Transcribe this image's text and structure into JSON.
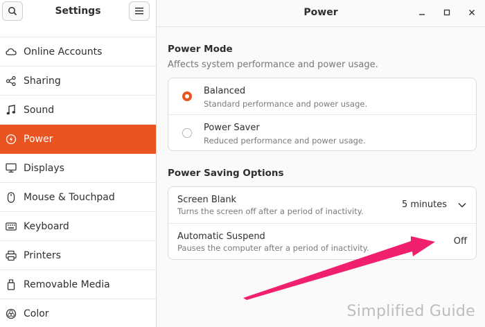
{
  "sidebar": {
    "title": "Settings",
    "items": [
      {
        "label": "",
        "icon": "privacy-icon"
      },
      {
        "label": "Online Accounts",
        "icon": "cloud-icon"
      },
      {
        "label": "Sharing",
        "icon": "share-icon"
      },
      {
        "label": "Sound",
        "icon": "music-note-icon"
      },
      {
        "label": "Power",
        "icon": "power-icon",
        "active": true
      },
      {
        "label": "Displays",
        "icon": "display-icon"
      },
      {
        "label": "Mouse & Touchpad",
        "icon": "mouse-icon"
      },
      {
        "label": "Keyboard",
        "icon": "keyboard-icon"
      },
      {
        "label": "Printers",
        "icon": "printer-icon"
      },
      {
        "label": "Removable Media",
        "icon": "removable-media-icon"
      },
      {
        "label": "Color",
        "icon": "color-icon"
      }
    ]
  },
  "main": {
    "title": "Power",
    "power_mode": {
      "title": "Power Mode",
      "subtitle": "Affects system performance and power usage.",
      "options": [
        {
          "label": "Balanced",
          "description": "Standard performance and power usage.",
          "selected": true
        },
        {
          "label": "Power Saver",
          "description": "Reduced performance and power usage.",
          "selected": false
        }
      ]
    },
    "power_saving": {
      "title": "Power Saving Options",
      "screen_blank": {
        "label": "Screen Blank",
        "description": "Turns the screen off after a period of inactivity.",
        "value": "5 minutes"
      },
      "automatic_suspend": {
        "label": "Automatic Suspend",
        "description": "Pauses the computer after a period of inactivity.",
        "value": "Off"
      }
    }
  },
  "watermark": "Simplified Guide",
  "colors": {
    "accent": "#e95420",
    "arrow": "#f0206e"
  }
}
